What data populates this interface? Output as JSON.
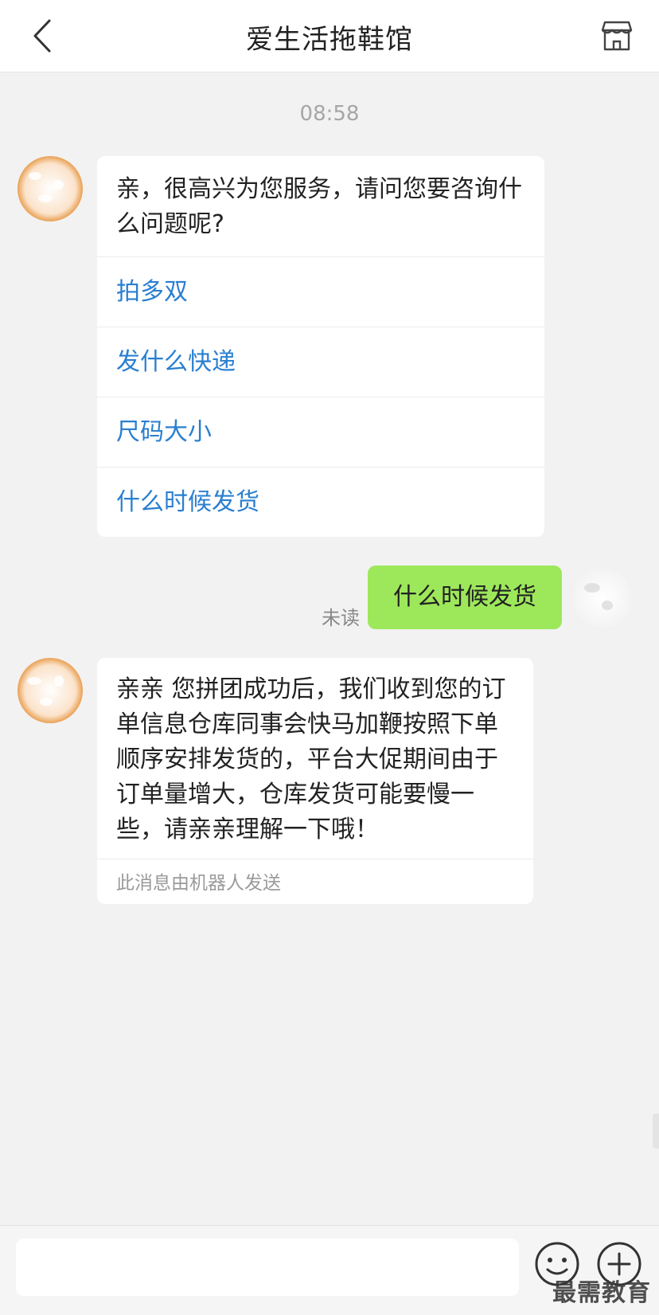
{
  "header": {
    "title": "爱生活拖鞋馆",
    "back_icon": "chevron-left-icon",
    "shop_icon": "store-icon"
  },
  "chat": {
    "timestamp": "08:58",
    "greeting": {
      "text": "亲，很高兴为您服务，请问您要咨询什么问题呢?",
      "options": [
        "拍多双",
        "发什么快递",
        "尺码大小",
        "什么时候发货"
      ]
    },
    "sent": {
      "text": "什么时候发货",
      "status": "未读"
    },
    "reply": {
      "text": "亲亲 您拼团成功后，我们收到您的订单信息仓库同事会快马加鞭按照下单顺序安排发货的，平台大促期间由于订单量增大，仓库发货可能要慢一些，请亲亲理解一下哦！",
      "note": "此消息由机器人发送"
    }
  },
  "footer": {
    "input_placeholder": "",
    "emoji_icon": "emoji-icon",
    "plus_icon": "plus-icon"
  },
  "watermark": "最需教育",
  "colors": {
    "link": "#2a7fd0",
    "sent_bubble": "#9de85a",
    "background": "#f2f2f2"
  }
}
